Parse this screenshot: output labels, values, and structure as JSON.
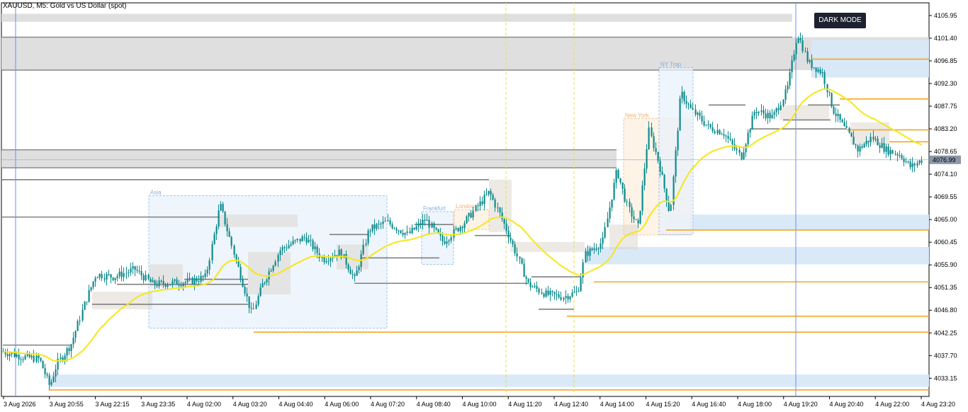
{
  "window": {
    "title": "XAUUSD, M5:  Gold vs US Dollar (spot)"
  },
  "controls": {
    "dark_mode_label": "DARK MODE"
  },
  "colors": {
    "bull_candle": "#0f8b8d",
    "bear_candle": "#0f8b8d",
    "ema": "#f5e71a",
    "zone_grey": "#dcdcdc",
    "zone_blue": "#d8e8f8",
    "level_orange": "#f5a623",
    "level_grey": "#808080",
    "session_box": "#e9f2fc",
    "vline_yellow": "#e8e04a",
    "vline_blue": "#6b8cff"
  },
  "chart_data": {
    "type": "candlestick",
    "symbol": "XAUUSD",
    "timeframe": "M5",
    "ylim": [
      4029.5,
      4108.5
    ],
    "current_price": "4076.99",
    "y_ticks": [
      "4105.95",
      "4101.40",
      "4096.85",
      "4092.30",
      "4087.75",
      "4083.20",
      "4078.65",
      "4074.10",
      "4069.55",
      "4065.00",
      "4060.45",
      "4055.90",
      "4051.35",
      "4046.80",
      "4042.25",
      "4037.70",
      "4033.15"
    ],
    "x_ticks": [
      "3 Aug 2026",
      "3 Aug 20:55",
      "3 Aug 22:15",
      "3 Aug 23:35",
      "4 Aug 02:00",
      "4 Aug 03:20",
      "4 Aug 04:40",
      "4 Aug 06:00",
      "4 Aug 07:20",
      "4 Aug 08:40",
      "4 Aug 10:00",
      "4 Aug 11:20",
      "4 Aug 12:40",
      "4 Aug 14:00",
      "4 Aug 15:20",
      "4 Aug 16:40",
      "4 Aug 18:00",
      "4 Aug 19:20",
      "4 Aug 20:40",
      "4 Aug 22:00",
      "4 Aug 23:20"
    ],
    "sessions": [
      {
        "name": "Asia",
        "color": "#7fb0e0"
      },
      {
        "name": "Frankfurt",
        "color": "#7fb0e0"
      },
      {
        "name": "London",
        "color": "#f0b070"
      },
      {
        "name": "New York",
        "color": "#f0b070"
      },
      {
        "name": "NY Trap",
        "color": "#7fb0e0"
      }
    ],
    "support_resistance_zones": [
      {
        "type": "grey",
        "from": 4101.6,
        "to": 4095.0
      },
      {
        "type": "grey",
        "from": 4079.0,
        "to": 4075.4
      },
      {
        "type": "grey",
        "from": 4106.3,
        "to": 4104.7
      },
      {
        "type": "blue",
        "from": 4101.0,
        "to": 4093.5
      },
      {
        "type": "blue",
        "from": 4066.0,
        "to": 4063.0
      },
      {
        "type": "blue",
        "from": 4059.5,
        "to": 4056.0
      },
      {
        "type": "blue",
        "from": 4033.9,
        "to": 4031.4
      }
    ],
    "levels_orange": [
      4097.2,
      4089.2,
      4083.0,
      4080.6,
      4062.9,
      4052.5,
      4045.6,
      4042.4,
      4030.8
    ],
    "candles": []
  }
}
